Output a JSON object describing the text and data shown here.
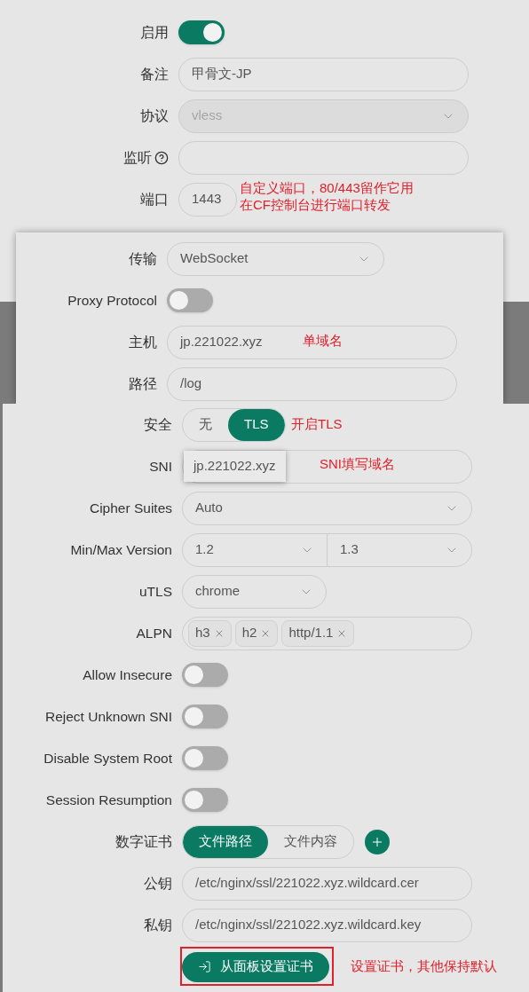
{
  "panels": [
    {
      "rows": [
        {
          "kind": "toggle",
          "label": "启用",
          "on": true
        },
        {
          "kind": "input",
          "label": "备注",
          "value": "甲骨文-JP"
        },
        {
          "kind": "select",
          "label": "协议",
          "value": "vless",
          "disabled": true
        },
        {
          "kind": "input",
          "label": "监听",
          "help": true
        },
        {
          "kind": "number",
          "label": "端口",
          "value": "1443",
          "note_lines": [
            "自定义端口，80/443留作它用",
            "在CF控制台进行端口转发"
          ]
        }
      ]
    },
    {
      "rows": [
        {
          "kind": "select_narrow",
          "label": "传输",
          "value": "WebSocket"
        },
        {
          "kind": "toggle",
          "label": "Proxy Protocol",
          "on": false
        },
        {
          "kind": "input",
          "label": "主机",
          "value": "jp.221022.xyz",
          "note_lines": [
            "单域名"
          ]
        },
        {
          "kind": "input",
          "label": "路径",
          "value": "/log"
        }
      ]
    },
    {
      "rows": [
        {
          "kind": "segmented",
          "label": "安全",
          "options": [
            {
              "label": "无",
              "selected": false
            },
            {
              "label": "TLS",
              "selected": true
            }
          ],
          "note_lines": [
            "开启TLS"
          ]
        },
        {
          "kind": "input",
          "label": "SNI",
          "suggestion": "jp.221022.xyz",
          "note_lines": [
            "SNI填写域名"
          ]
        },
        {
          "kind": "select",
          "label": "Cipher Suites",
          "value": "Auto"
        },
        {
          "kind": "select_pair",
          "label": "Min/Max Version",
          "values": [
            "1.2",
            "1.3"
          ]
        },
        {
          "kind": "select_small",
          "label": "uTLS",
          "value": "chrome"
        },
        {
          "kind": "tags",
          "label": "ALPN",
          "tags": [
            "h3",
            "h2",
            "http/1.1"
          ]
        },
        {
          "kind": "toggle",
          "label": "Allow Insecure",
          "on": false
        },
        {
          "kind": "toggle",
          "label": "Reject Unknown SNI",
          "on": false
        },
        {
          "kind": "toggle",
          "label": "Disable System Root",
          "on": false
        },
        {
          "kind": "toggle",
          "label": "Session Resumption",
          "on": false
        },
        {
          "kind": "segmented",
          "label": "数字证书",
          "options": [
            {
              "label": "文件路径",
              "selected": true
            },
            {
              "label": "文件内容",
              "selected": false
            }
          ],
          "add": true
        },
        {
          "kind": "input",
          "label": "公钥",
          "value": "/etc/nginx/ssl/221022.xyz.wildcard.cer"
        },
        {
          "kind": "input",
          "label": "私钥",
          "value": "/etc/nginx/ssl/221022.xyz.wildcard.key"
        },
        {
          "kind": "button",
          "label": "从面板设置证书",
          "highlighted": true,
          "note_lines": [
            "设置证书，其他保持默认"
          ]
        }
      ]
    }
  ]
}
